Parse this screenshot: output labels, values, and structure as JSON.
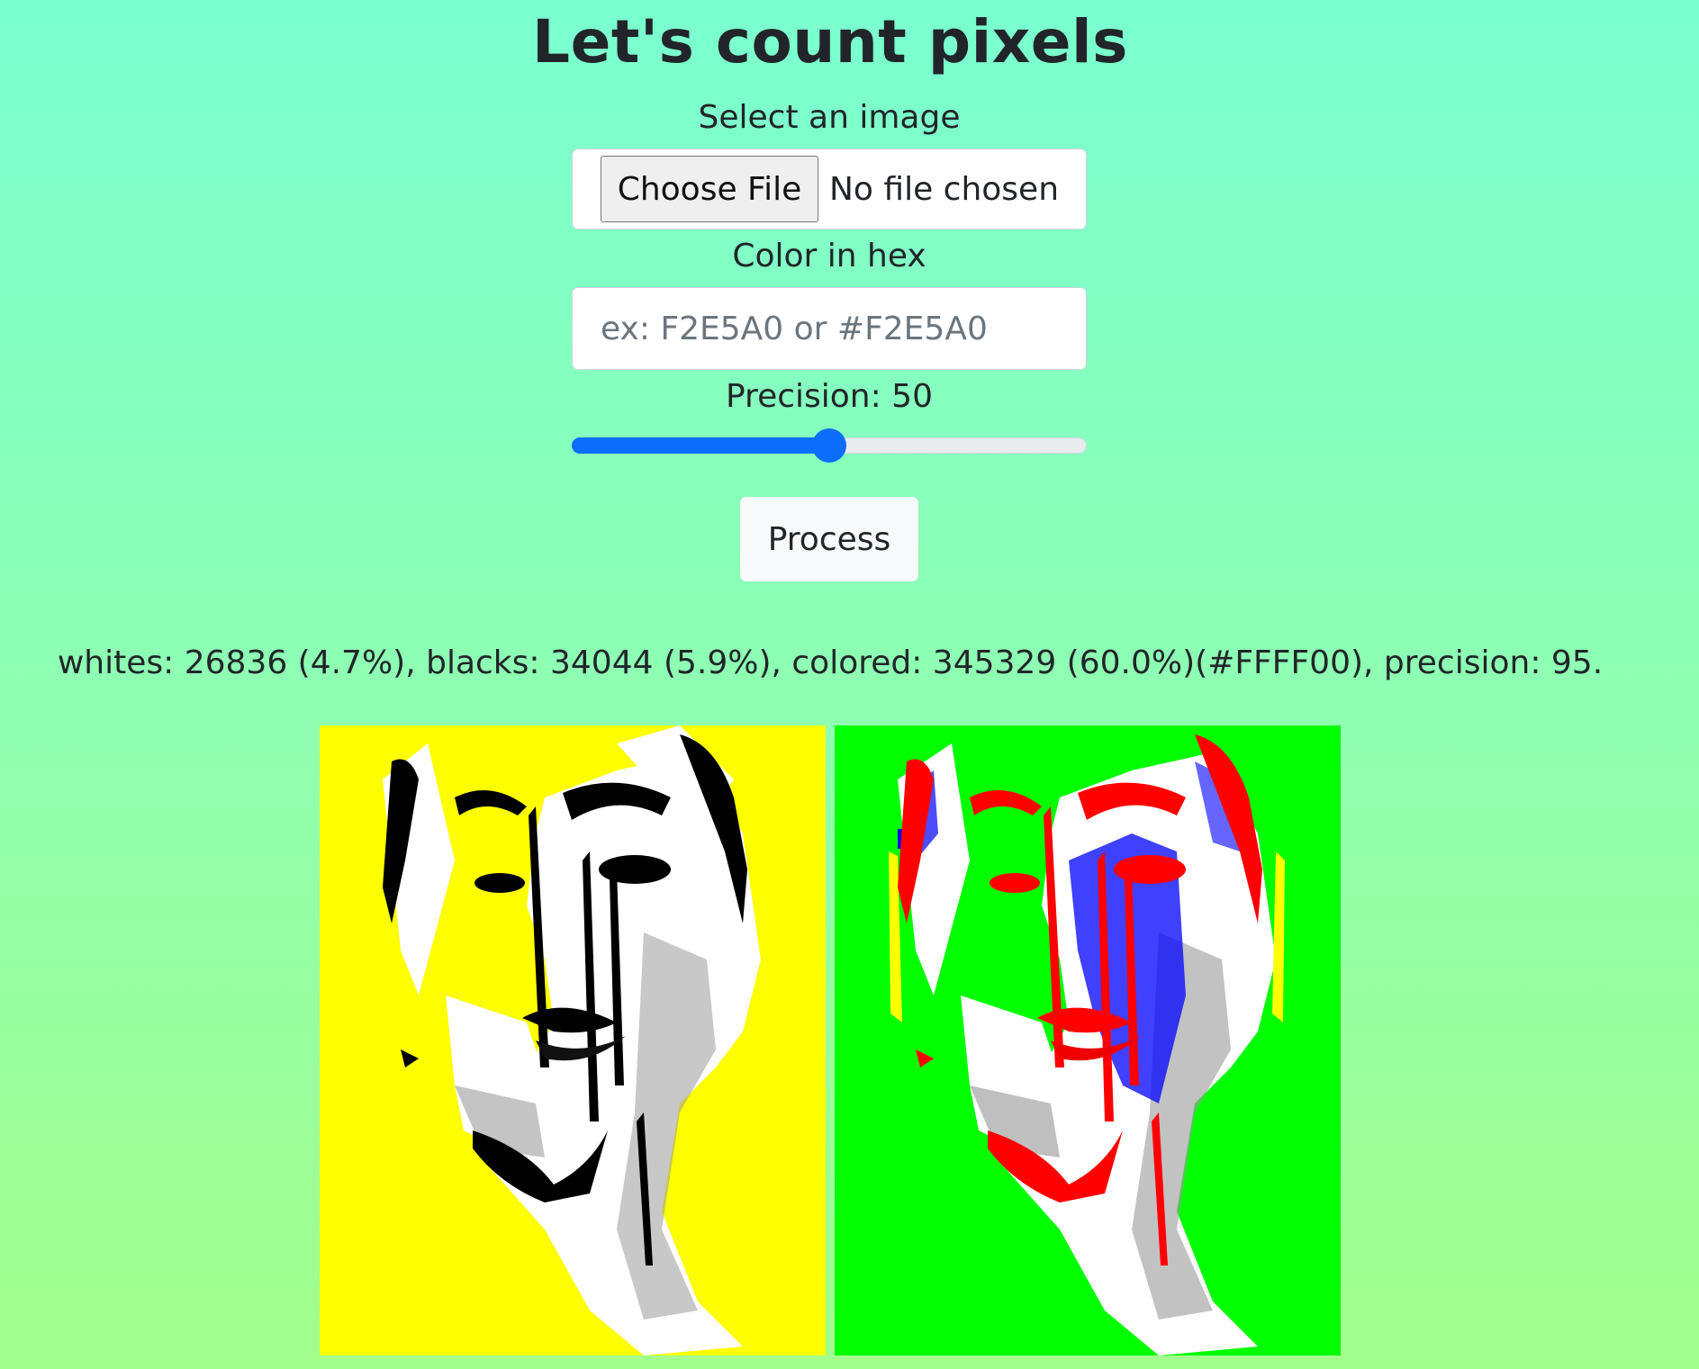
{
  "page": {
    "title": "Let's count pixels"
  },
  "form": {
    "image_label": "Select an image",
    "file_button_label": "Choose File",
    "file_status": "No file chosen",
    "color_label": "Color in hex",
    "color_value": "",
    "color_placeholder": "ex: F2E5A0 or #F2E5A0",
    "precision_label": "Precision: 50",
    "precision_value": 50,
    "precision_min": 0,
    "precision_max": 100,
    "process_button_label": "Process"
  },
  "result": {
    "text": "whites: 26836 (4.7%), blacks: 34044 (5.9%), colored: 345329 (60.0%)(#FFFF00), precision: 95."
  },
  "images": {
    "original": {
      "background_color": "#FFFF00"
    },
    "processed": {
      "background_color": "#00FF00",
      "highlight_colors": [
        "#FF0000",
        "#0000FF"
      ]
    }
  },
  "colors": {
    "accent": "#0D6EFD",
    "page_gradient_top": "#7AFFD0",
    "page_gradient_bottom": "#A3FF8C"
  }
}
